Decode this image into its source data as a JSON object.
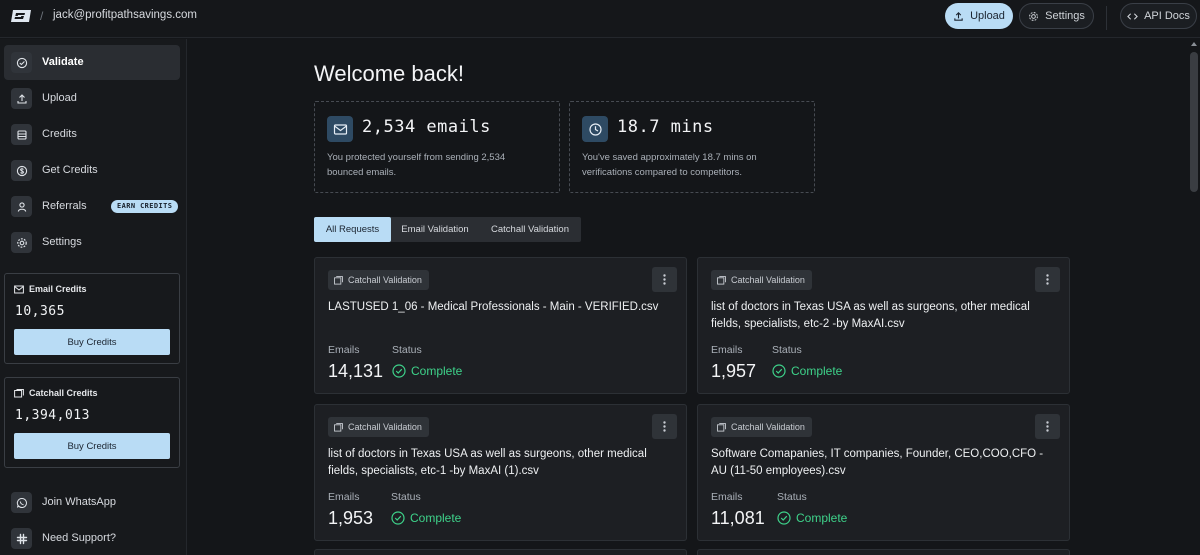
{
  "header": {
    "separator": "/",
    "account_email": "jack@profitpathsavings.com",
    "upload_label": "Upload",
    "settings_label": "Settings",
    "api_docs_label": "API Docs"
  },
  "sidebar": {
    "items": [
      {
        "label": "Validate",
        "icon": "check-circle-icon"
      },
      {
        "label": "Upload",
        "icon": "upload-icon"
      },
      {
        "label": "Credits",
        "icon": "credits-icon"
      },
      {
        "label": "Get Credits",
        "icon": "dollar-coin-icon"
      },
      {
        "label": "Referrals",
        "icon": "user-icon",
        "badge": "EARN CREDITS"
      },
      {
        "label": "Settings",
        "icon": "gear-icon"
      }
    ],
    "email_credits": {
      "title": "Email Credits",
      "value": "10,365",
      "button": "Buy Credits"
    },
    "catchall_credits": {
      "title": "Catchall Credits",
      "value": "1,394,013",
      "button": "Buy Credits"
    },
    "footer_items": [
      {
        "label": "Join WhatsApp",
        "icon": "whatsapp-icon"
      },
      {
        "label": "Need Support?",
        "icon": "slack-icon"
      }
    ]
  },
  "main": {
    "title": "Welcome back!",
    "stats": [
      {
        "value": "2,534 emails",
        "description": "You protected yourself from sending 2,534 bounced emails.",
        "icon": "envelope-icon"
      },
      {
        "value": "18.7 mins",
        "description": "You've saved approximately 18.7 mins on verifications compared to competitors.",
        "icon": "clock-icon"
      }
    ],
    "tabs": [
      "All Requests",
      "Email Validation",
      "Catchall Validation"
    ],
    "active_tab": "All Requests",
    "emails_label": "Emails",
    "status_label": "Status",
    "cards": [
      {
        "type": "Catchall Validation",
        "title": "LASTUSED 1_06 - Medical Professionals - Main - VERIFIED.csv",
        "emails": "14,131",
        "status": "Complete"
      },
      {
        "type": "Catchall Validation",
        "title": "list of doctors in Texas USA as well as surgeons, other medical fields, specialists, etc-2 -by MaxAI.csv",
        "emails": "1,957",
        "status": "Complete"
      },
      {
        "type": "Catchall Validation",
        "title": "list of doctors in Texas USA as well as surgeons, other medical fields, specialists, etc-1 -by MaxAI (1).csv",
        "emails": "1,953",
        "status": "Complete"
      },
      {
        "type": "Catchall Validation",
        "title": "Software Comapanies, IT companies, Founder, CEO,COO,CFO - AU (11-50 employees).csv",
        "emails": "11,081",
        "status": "Complete"
      }
    ]
  },
  "colors": {
    "accent": "#b9dcf5",
    "success": "#3ed28a",
    "background": "#141619"
  }
}
